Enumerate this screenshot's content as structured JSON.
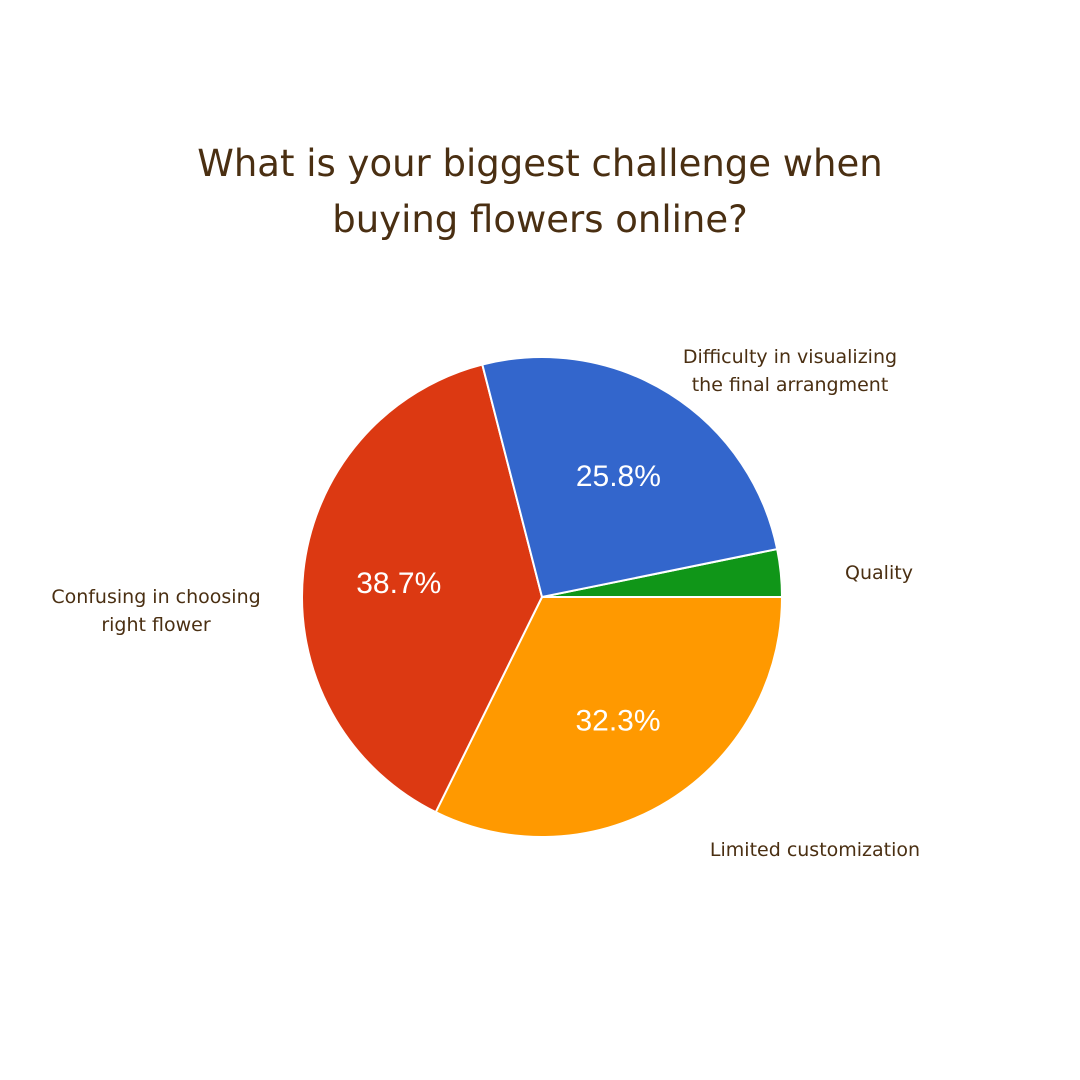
{
  "chart_data": {
    "type": "pie",
    "title_lines": [
      "What is your biggest challenge when",
      "buying flowers online?"
    ],
    "slices": [
      {
        "label_lines": [
          "Quality"
        ],
        "value": 3.2,
        "percent_label": "",
        "color": "#109618"
      },
      {
        "label_lines": [
          "Difficulty in visualizing",
          "the final arrangment"
        ],
        "value": 32.3,
        "percent_label": "32.3%",
        "color": "#ff9900"
      },
      {
        "label_lines": [
          "Confusing in choosing",
          "right flower"
        ],
        "value": 38.7,
        "percent_label": "38.7%",
        "color": "#dc3912"
      },
      {
        "label_lines": [
          "Limited customization"
        ],
        "value": 25.8,
        "percent_label": "25.8%",
        "color": "#3366cc"
      }
    ],
    "legend": "none"
  }
}
